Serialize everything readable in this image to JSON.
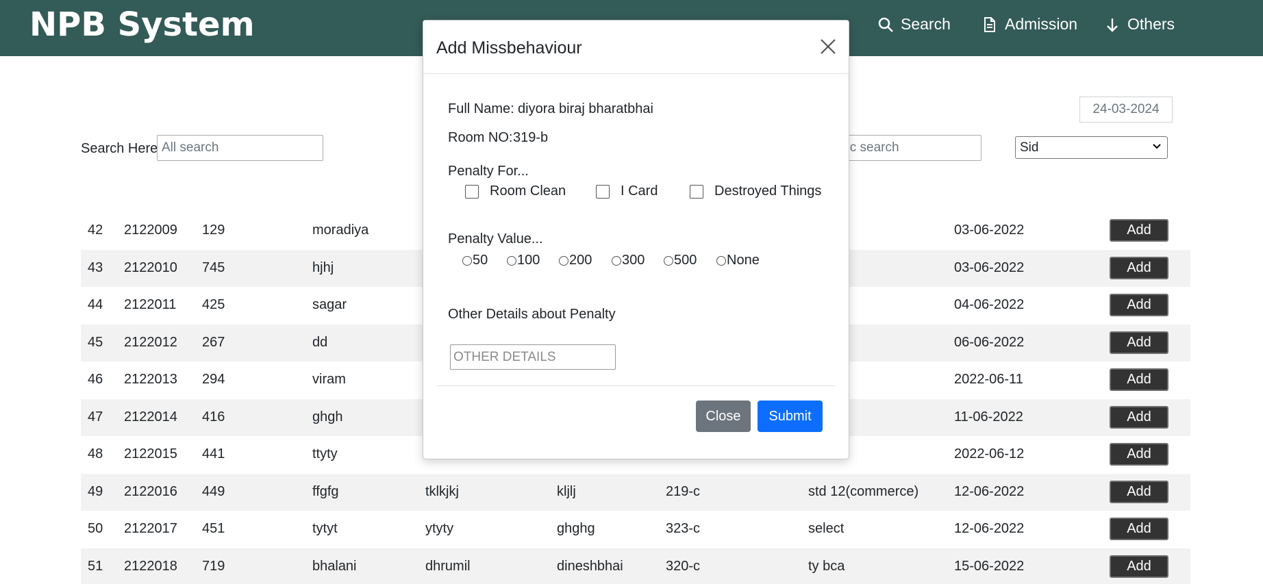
{
  "navbar": {
    "brand": "NPB System",
    "links": [
      {
        "label": "Search",
        "icon": "search-icon"
      },
      {
        "label": "Admission",
        "icon": "document-icon"
      },
      {
        "label": "Others",
        "icon": "arrow-down-icon"
      }
    ],
    "bg_color": "#335b58"
  },
  "filters": {
    "date": "24-03-2024",
    "search_label": "Search Here",
    "search_placeholder": "All search",
    "specific_placeholder": "ific search",
    "select_value": "Sid"
  },
  "table": {
    "add_label": "Add",
    "rows": [
      {
        "no": "42",
        "sid": "2122009",
        "roll": "129",
        "surname": "moradiya",
        "name": "",
        "father": "",
        "room": "",
        "std": "",
        "date": "03-06-2022"
      },
      {
        "no": "43",
        "sid": "2122010",
        "roll": "745",
        "surname": "hjhj",
        "name": "",
        "father": "",
        "room": "",
        "std": "",
        "date": "03-06-2022"
      },
      {
        "no": "44",
        "sid": "2122011",
        "roll": "425",
        "surname": "sagar",
        "name": "",
        "father": "",
        "room": "",
        "std": "",
        "date": "04-06-2022"
      },
      {
        "no": "45",
        "sid": "2122012",
        "roll": "267",
        "surname": "dd",
        "name": "",
        "father": "",
        "room": "",
        "std": "",
        "date": "06-06-2022"
      },
      {
        "no": "46",
        "sid": "2122013",
        "roll": "294",
        "surname": "viram",
        "name": "",
        "father": "",
        "room": "",
        "std": "",
        "date": "2022-06-11"
      },
      {
        "no": "47",
        "sid": "2122014",
        "roll": "416",
        "surname": "ghgh",
        "name": "",
        "father": "",
        "room": "",
        "std": "",
        "date": "11-06-2022"
      },
      {
        "no": "48",
        "sid": "2122015",
        "roll": "441",
        "surname": "ttyty",
        "name": "",
        "father": "",
        "room": "",
        "std": "",
        "date": "2022-06-12"
      },
      {
        "no": "49",
        "sid": "2122016",
        "roll": "449",
        "surname": "ffgfg",
        "name": "tklkjkj",
        "father": "kljlj",
        "room": "219-c",
        "std": "std 12(commerce)",
        "date": "12-06-2022"
      },
      {
        "no": "50",
        "sid": "2122017",
        "roll": "451",
        "surname": "tytyt",
        "name": "ytyty",
        "father": "ghghg",
        "room": "323-c",
        "std": "select",
        "date": "12-06-2022"
      },
      {
        "no": "51",
        "sid": "2122018",
        "roll": "719",
        "surname": "bhalani",
        "name": "dhrumil",
        "father": "dineshbhai",
        "room": "320-c",
        "std": "ty bca",
        "date": "15-06-2022"
      }
    ]
  },
  "modal": {
    "title": "Add Missbehaviour",
    "full_name_label": "Full Name:",
    "full_name_value": "diyora biraj bharatbhai",
    "room_label": "Room NO:",
    "room_value": "319-b",
    "penalty_for_label": "Penalty For...",
    "penalty_for_options": [
      "Room Clean",
      "I Card",
      "Destroyed Things"
    ],
    "penalty_value_label": "Penalty Value...",
    "penalty_values": [
      "50",
      "100",
      "200",
      "300",
      "500",
      "None"
    ],
    "other_details_label": "Other Details about Penalty",
    "other_details_placeholder": "OTHER DETAILS",
    "close_label": "Close",
    "submit_label": "Submit",
    "submit_color": "#0d6efd",
    "close_color": "#6c757d"
  }
}
